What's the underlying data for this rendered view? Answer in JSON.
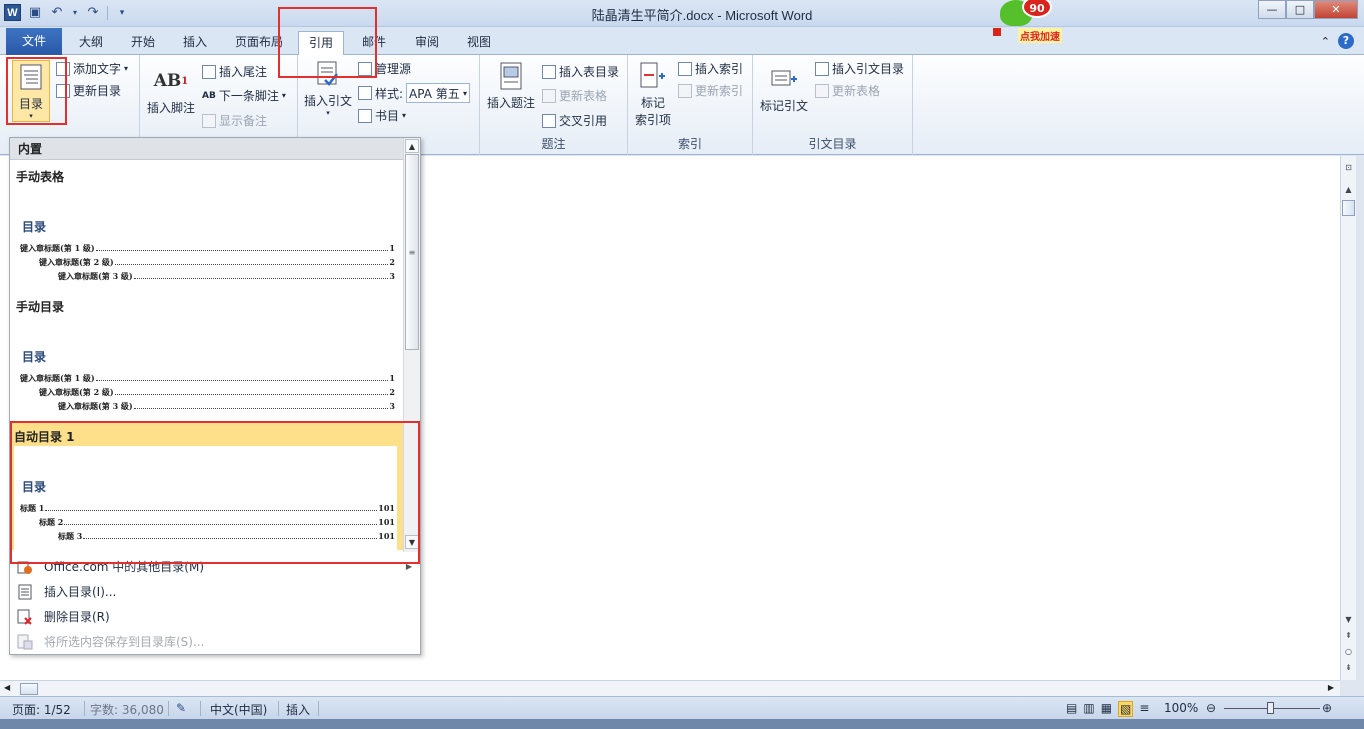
{
  "window": {
    "title": "陆晶清生平简介.docx - Microsoft Word",
    "controls": {
      "minimize": "—",
      "maximize": "□",
      "close": "✕"
    }
  },
  "mascot": {
    "badge": "90",
    "caption": "点我加速"
  },
  "tabs": [
    {
      "label": "文件"
    },
    {
      "label": "大纲"
    },
    {
      "label": "开始"
    },
    {
      "label": "插入"
    },
    {
      "label": "页面布局"
    },
    {
      "label": "引用"
    },
    {
      "label": "邮件"
    },
    {
      "label": "审阅"
    },
    {
      "label": "视图"
    }
  ],
  "ribbon": {
    "toc": {
      "big": "目录",
      "add_text": "添加文字",
      "update": "更新目录"
    },
    "footnotes": {
      "insert_footnote": "插入脚注",
      "insert_endnote": "插入尾注",
      "next_footnote": "下一条脚注",
      "show_notes": "显示备注"
    },
    "citations": {
      "insert_citation": "插入引文",
      "manage_sources": "管理源",
      "style_label": "样式:",
      "style_value": "APA 第五",
      "bibliography": "书目"
    },
    "captions": {
      "insert_caption": "插入题注",
      "insert_tof": "插入表目录",
      "update_table": "更新表格",
      "cross_ref": "交叉引用",
      "group_label": "题注"
    },
    "index": {
      "mark_entry_1": "标记",
      "mark_entry_2": "索引项",
      "insert_index": "插入索引",
      "update_index": "更新索引",
      "group_label": "索引"
    },
    "toa": {
      "mark_citation": "标记引文",
      "insert_toa": "插入引文目录",
      "update_table": "更新表格",
      "group_label": "引文目录"
    }
  },
  "toc_dropdown": {
    "section": "内置",
    "items": [
      {
        "title": "手动表格",
        "heading": "目录",
        "lines": [
          {
            "label": "键入章标题(第 1 级)",
            "page": "1"
          },
          {
            "label": "键入章标题(第 2 级)",
            "page": "2"
          },
          {
            "label": "键入章标题(第 3 级)",
            "page": "3"
          }
        ]
      },
      {
        "title": "手动目录",
        "heading": "目录",
        "lines": [
          {
            "label": "键入章标题(第 1 级)",
            "page": "1"
          },
          {
            "label": "键入章标题(第 2 级)",
            "page": "2"
          },
          {
            "label": "键入章标题(第 3 级)",
            "page": "3"
          }
        ]
      },
      {
        "title": "自动目录 1",
        "heading": "目录",
        "lines": [
          {
            "label": "标题 1",
            "page": "101"
          },
          {
            "label": "标题 2",
            "page": "101"
          },
          {
            "label": "标题 3",
            "page": "101"
          }
        ]
      }
    ],
    "menu": [
      {
        "label": "Office.com 中的其他目录(M)",
        "icon": "office-icon",
        "disabled": false
      },
      {
        "label": "插入目录(I)...",
        "icon": "document-icon",
        "disabled": false
      },
      {
        "label": "删除目录(R)",
        "icon": "delete-document-icon",
        "disabled": false
      },
      {
        "label": "将所选内容保存到目录库(S)...",
        "icon": "save-gallery-icon",
        "disabled": true
      }
    ]
  },
  "status": {
    "page": "页面: 1/52",
    "words": "字数: 36,080",
    "language": "中文(中国)",
    "mode": "插入",
    "zoom": "100%"
  }
}
